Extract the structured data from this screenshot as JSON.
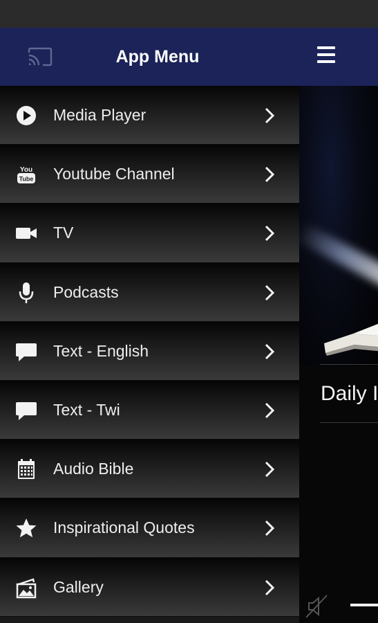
{
  "drawer": {
    "title": "App Menu",
    "header_color": "#1b2358",
    "cast_icon": "cast-icon",
    "items": [
      {
        "label": "Media Player",
        "icon": "play-circle-icon"
      },
      {
        "label": "Youtube Channel",
        "icon": "youtube-icon"
      },
      {
        "label": "TV",
        "icon": "video-camera-icon"
      },
      {
        "label": "Podcasts",
        "icon": "microphone-icon"
      },
      {
        "label": "Text - English",
        "icon": "chat-bubble-icon"
      },
      {
        "label": "Text - Twi",
        "icon": "chat-bubble-icon"
      },
      {
        "label": "Audio Bible",
        "icon": "calendar-icon"
      },
      {
        "label": "Inspirational Quotes",
        "icon": "star-icon"
      },
      {
        "label": "Gallery",
        "icon": "gallery-icon"
      }
    ]
  },
  "background_app": {
    "menu_icon": "hamburger-icon",
    "section_title": "Daily I",
    "mute_icon": "mute-icon"
  },
  "youtube_icon_text": {
    "top": "You",
    "bottom": "Tube"
  }
}
